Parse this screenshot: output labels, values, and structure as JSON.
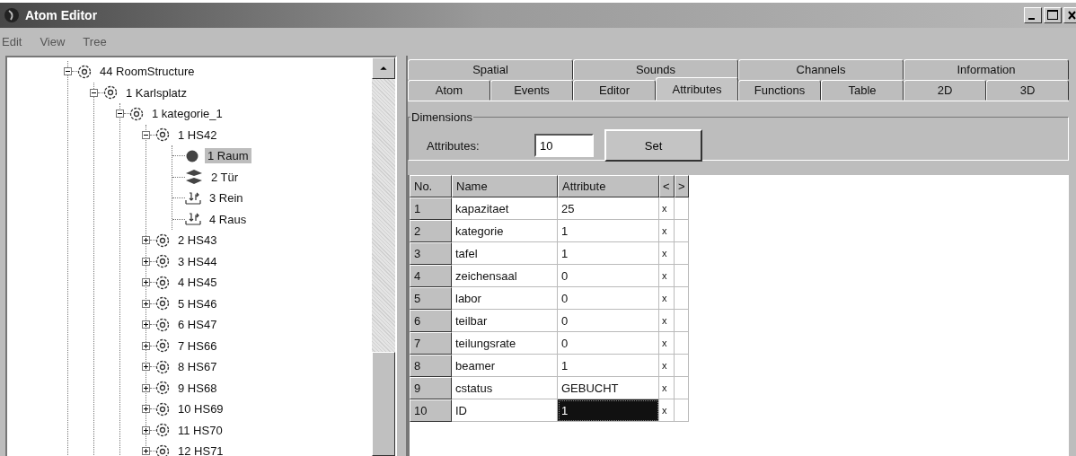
{
  "window": {
    "title": "Atom Editor"
  },
  "menu": [
    {
      "label": "Edit"
    },
    {
      "label": "View"
    },
    {
      "label": "Tree"
    }
  ],
  "tree": [
    {
      "label": "44 RoomStructure",
      "kind": "group",
      "expanded": true,
      "selected": false,
      "children": [
        {
          "label": "1 Karlsplatz",
          "kind": "group",
          "expanded": true,
          "selected": false,
          "children": [
            {
              "label": "1 kategorie_1",
              "kind": "group",
              "expanded": true,
              "selected": false,
              "children": [
                {
                  "label": "1 HS42",
                  "kind": "group",
                  "expanded": true,
                  "selected": false,
                  "children": [
                    {
                      "label": "1 Raum",
                      "kind": "room",
                      "selected": true
                    },
                    {
                      "label": "2 Tür",
                      "kind": "door",
                      "selected": false
                    },
                    {
                      "label": "3 Rein",
                      "kind": "flow",
                      "selected": false
                    },
                    {
                      "label": "4 Raus",
                      "kind": "flow",
                      "selected": false
                    }
                  ]
                },
                {
                  "label": "2 HS43",
                  "kind": "group",
                  "expanded": false,
                  "selected": false
                },
                {
                  "label": "3 HS44",
                  "kind": "group",
                  "expanded": false,
                  "selected": false
                },
                {
                  "label": "4 HS45",
                  "kind": "group",
                  "expanded": false,
                  "selected": false
                },
                {
                  "label": "5 HS46",
                  "kind": "group",
                  "expanded": false,
                  "selected": false
                },
                {
                  "label": "6 HS47",
                  "kind": "group",
                  "expanded": false,
                  "selected": false
                },
                {
                  "label": "7 HS66",
                  "kind": "group",
                  "expanded": false,
                  "selected": false
                },
                {
                  "label": "8 HS67",
                  "kind": "group",
                  "expanded": false,
                  "selected": false
                },
                {
                  "label": "9 HS68",
                  "kind": "group",
                  "expanded": false,
                  "selected": false
                },
                {
                  "label": "10 HS69",
                  "kind": "group",
                  "expanded": false,
                  "selected": false
                },
                {
                  "label": "11 HS70",
                  "kind": "group",
                  "expanded": false,
                  "selected": false
                },
                {
                  "label": "12 HS71",
                  "kind": "group",
                  "expanded": false,
                  "selected": false
                }
              ]
            }
          ]
        }
      ]
    }
  ],
  "tab_rows": [
    [
      {
        "label": "Spatial",
        "selected": false
      },
      {
        "label": "Sounds",
        "selected": false
      },
      {
        "label": "Channels",
        "selected": false
      },
      {
        "label": "Information",
        "selected": false
      }
    ],
    [
      {
        "label": "Atom",
        "selected": false
      },
      {
        "label": "Events",
        "selected": false
      },
      {
        "label": "Editor",
        "selected": false
      },
      {
        "label": "Attributes",
        "selected": true
      },
      {
        "label": "Functions",
        "selected": false
      },
      {
        "label": "Table",
        "selected": false
      },
      {
        "label": "2D",
        "selected": false
      },
      {
        "label": "3D",
        "selected": false
      }
    ]
  ],
  "dimensions": {
    "title": "Dimensions",
    "label": "Attributes:",
    "value": "10",
    "button": "Set"
  },
  "table": {
    "columns": [
      "No.",
      "Name",
      "Attribute"
    ],
    "scroll_buttons": [
      "<",
      ">"
    ],
    "rows": [
      {
        "no": "1",
        "name": "kapazitaet",
        "value": "25",
        "flag": "x",
        "selected": false
      },
      {
        "no": "2",
        "name": "kategorie",
        "value": "1",
        "flag": "x",
        "selected": false
      },
      {
        "no": "3",
        "name": "tafel",
        "value": "1",
        "flag": "x",
        "selected": false
      },
      {
        "no": "4",
        "name": "zeichensaal",
        "value": "0",
        "flag": "x",
        "selected": false
      },
      {
        "no": "5",
        "name": "labor",
        "value": "0",
        "flag": "x",
        "selected": false
      },
      {
        "no": "6",
        "name": "teilbar",
        "value": "0",
        "flag": "x",
        "selected": false
      },
      {
        "no": "7",
        "name": "teilungsrate",
        "value": "0",
        "flag": "x",
        "selected": false
      },
      {
        "no": "8",
        "name": "beamer",
        "value": "1",
        "flag": "x",
        "selected": false
      },
      {
        "no": "9",
        "name": "cstatus",
        "value": "GEBUCHT",
        "flag": "x",
        "selected": false
      },
      {
        "no": "10",
        "name": "ID",
        "value": "1",
        "flag": "x",
        "selected": true
      }
    ]
  }
}
